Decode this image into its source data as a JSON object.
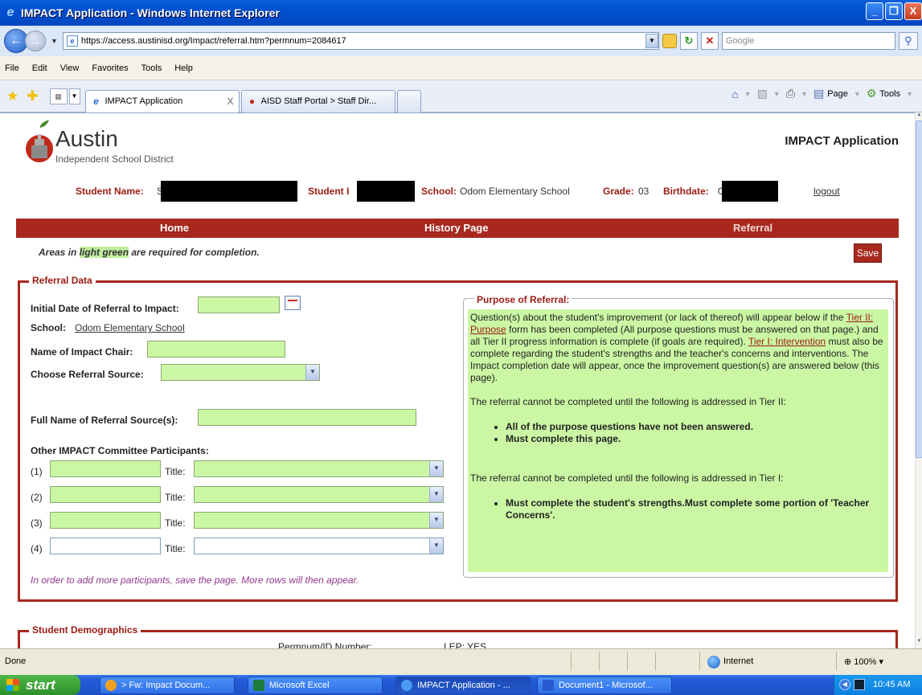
{
  "window": {
    "title": "IMPACT Application - Windows Internet Explorer",
    "minimize": "_",
    "restore": "❐",
    "close": "X"
  },
  "address": {
    "url": "https://access.austinisd.org/Impact/referral.htm?permnum=2084617",
    "search_placeholder": "Google"
  },
  "menu": [
    "File",
    "Edit",
    "View",
    "Favorites",
    "Tools",
    "Help"
  ],
  "tabs": [
    {
      "label": "IMPACT Application",
      "close": "X"
    },
    {
      "label": "AISD Staff Portal > Staff Dir..."
    }
  ],
  "commands": {
    "page": "Page",
    "tools": "Tools"
  },
  "header": {
    "logo_main": "Austin",
    "logo_sub": "Independent School District",
    "app_title": "IMPACT Application"
  },
  "student": {
    "name_label": "Student Name:",
    "name_value": "S",
    "id_label": "Student I",
    "school_label": "School:",
    "school_value": "Odom Elementary School",
    "grade_label": "Grade:",
    "grade_value": "03",
    "birthdate_label": "Birthdate:",
    "birthdate_value": "0",
    "logout": "logout"
  },
  "nav": {
    "home": "Home",
    "history": "History Page",
    "referral": "Referral"
  },
  "required_note": {
    "prefix": "Areas in ",
    "highlight": "light green",
    "suffix": " are required for completion."
  },
  "save_label": "Save",
  "referral": {
    "legend": "Referral Data",
    "initial_date_label": "Initial Date of Referral to Impact:",
    "school_label": "School:",
    "school_link": "Odom Elementary School",
    "chair_label": "Name of Impact Chair:",
    "source_label": "Choose Referral Source:",
    "full_name_label": "Full Name of Referral Source(s):",
    "participants_label": "Other IMPACT Committee Participants:",
    "title_label": "Title:",
    "rows": [
      "(1)",
      "(2)",
      "(3)",
      "(4)"
    ],
    "note": "In order to add more participants, save the page. More rows will then appear."
  },
  "purpose": {
    "legend": "Purpose of Referral:",
    "p1_a": "Question(s) about the student's improvement (or lack of thereof) will appear below if the ",
    "p1_link1": "Tier II: Purpose",
    "p1_b": " form has been completed (All purpose questions must be answered on that page.) and all Tier II progress information is complete (if goals are required). ",
    "p1_link2": "Tier I: Intervention",
    "p1_c": " must also be complete regarding the student's strengths and the teacher's concerns and interventions. The Impact completion date will appear, once the improvement question(s) are answered below (this page).",
    "tier2_head": "The referral cannot be completed until the following is addressed in Tier II:",
    "tier2_items": [
      "All of the purpose questions have not been answered.",
      "Must complete this page."
    ],
    "tier1_head": "The referral cannot be completed until the following is addressed in Tier I:",
    "tier1_items": [
      "Must complete the student's strengths.Must complete some portion of 'Teacher Concerns'."
    ]
  },
  "demographics": {
    "legend": "Student Demographics",
    "permnum_label": "Permnum/ID Number:",
    "lep_label": "LEP: YES"
  },
  "status": {
    "text": "Done",
    "zone": "Internet",
    "zoom": "100%"
  },
  "taskbar": {
    "start": "start",
    "items": [
      "> Fw: Impact Docum...",
      "Microsoft Excel",
      "IMPACT Application - ...",
      "Document1 - Microsof..."
    ],
    "clock": "10:45 AM"
  }
}
